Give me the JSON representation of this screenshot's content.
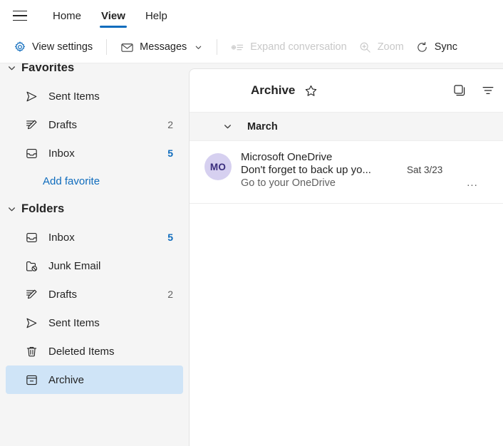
{
  "window": {
    "app": "Outlook"
  },
  "ribbon": {
    "menu_icon": "hamburger-menu-icon",
    "tabs": [
      {
        "label": "Home",
        "active": false
      },
      {
        "label": "View",
        "active": true
      },
      {
        "label": "Help",
        "active": false
      }
    ]
  },
  "toolbar": {
    "items": [
      {
        "label": "View settings",
        "icon": "gear-icon",
        "disabled": false,
        "has_chevron": false
      },
      {
        "label": "Messages",
        "icon": "envelope-icon",
        "disabled": false,
        "has_chevron": true
      },
      {
        "label": "Expand conversation",
        "icon": "expand-conversation-icon",
        "disabled": true,
        "has_chevron": false
      },
      {
        "label": "Zoom",
        "icon": "magnifier-icon",
        "disabled": true,
        "has_chevron": false
      },
      {
        "label": "Sync",
        "icon": "sync-icon",
        "disabled": false,
        "has_chevron": false
      }
    ]
  },
  "sidebar": {
    "favorites": {
      "title": "Favorites",
      "items": [
        {
          "label": "Sent Items",
          "icon": "send-icon",
          "count": ""
        },
        {
          "label": "Drafts",
          "icon": "draft-pencil-icon",
          "count": "2",
          "unread": false
        },
        {
          "label": "Inbox",
          "icon": "inbox-tray-icon",
          "count": "5",
          "unread": true
        }
      ],
      "add_favorite_label": "Add favorite"
    },
    "folders": {
      "title": "Folders",
      "items": [
        {
          "label": "Inbox",
          "icon": "inbox-tray-icon",
          "count": "5",
          "unread": true,
          "selected": false
        },
        {
          "label": "Junk Email",
          "icon": "junk-folder-icon",
          "count": "",
          "selected": false
        },
        {
          "label": "Drafts",
          "icon": "draft-pencil-icon",
          "count": "2",
          "unread": false,
          "selected": false
        },
        {
          "label": "Sent Items",
          "icon": "send-icon",
          "count": "",
          "selected": false
        },
        {
          "label": "Deleted Items",
          "icon": "trash-icon",
          "count": "",
          "selected": false
        },
        {
          "label": "Archive",
          "icon": "archive-box-icon",
          "count": "",
          "selected": true
        }
      ]
    }
  },
  "message_list": {
    "title": "Archive",
    "star_icon": "star-outline-icon",
    "layout_icon": "conversation-layout-icon",
    "filter_icon": "filter-icon",
    "date_group": {
      "label": "March",
      "chevron": "chevron-down-icon"
    },
    "messages": [
      {
        "avatar_initials": "MO",
        "sender": "Microsoft OneDrive",
        "subject": "Don't forget to back up yo...",
        "preview": "Go to your OneDrive",
        "date": "Sat 3/23",
        "more_label": "..."
      }
    ]
  },
  "colors": {
    "accent": "#0f6cbd",
    "selected_bg": "#cfe4f7",
    "avatar_bg": "#d6d0f0",
    "avatar_fg": "#3b2e7e",
    "surface": "#ffffff",
    "canvas": "#f5f5f5"
  }
}
